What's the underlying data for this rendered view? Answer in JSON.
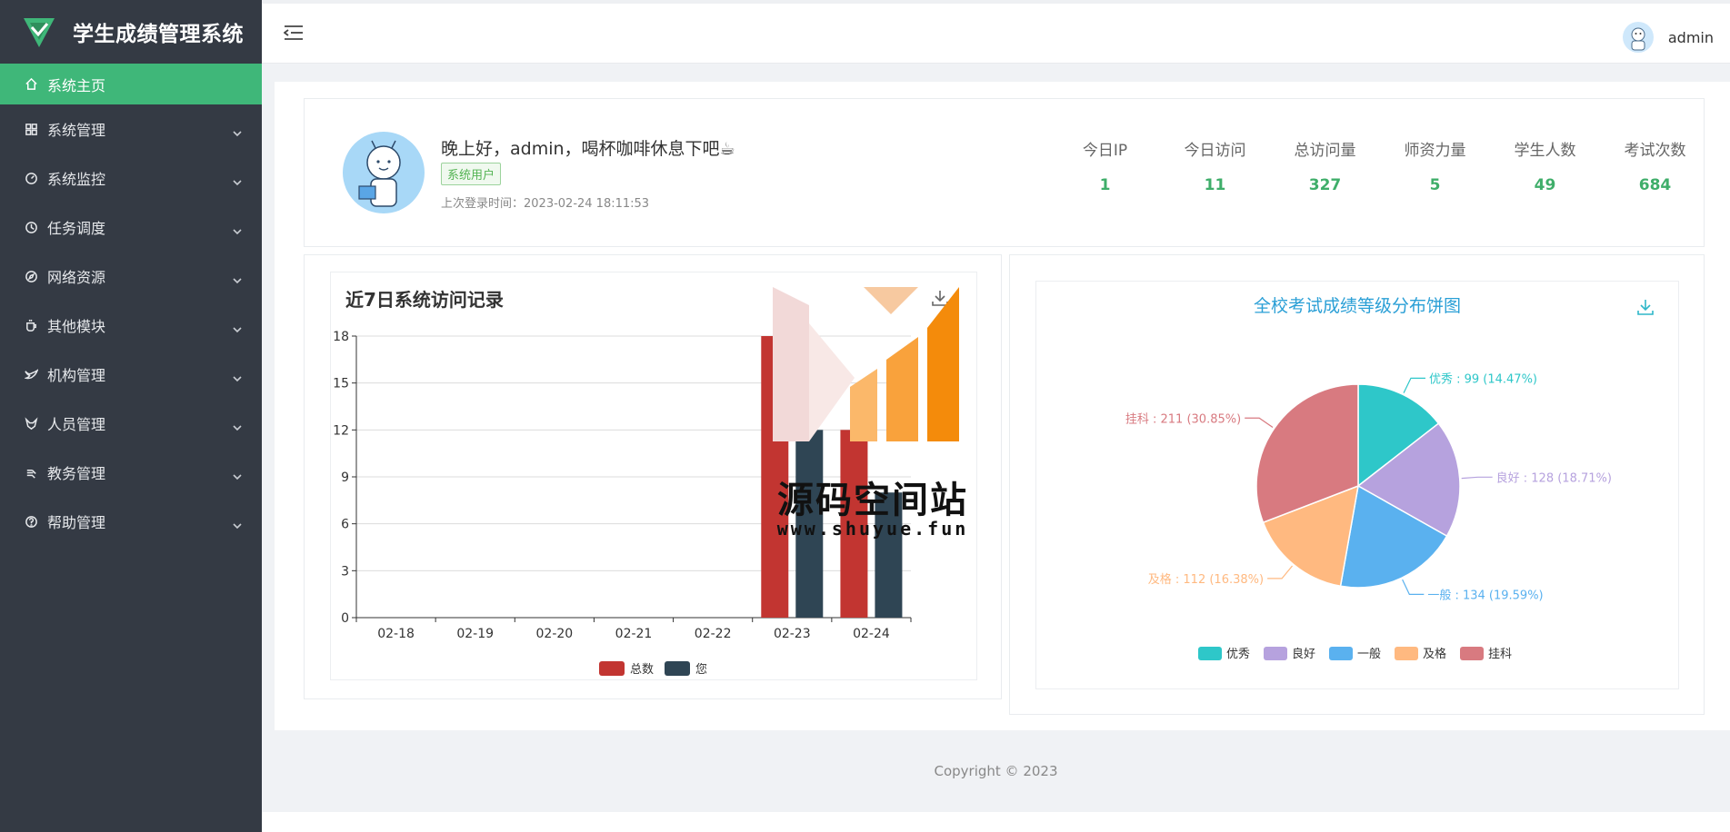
{
  "app": {
    "title": "学生成绩管理系统"
  },
  "sidebar": {
    "items": [
      {
        "label": "系统主页",
        "icon": "home-icon",
        "active": true
      },
      {
        "label": "系统管理",
        "icon": "grid-icon"
      },
      {
        "label": "系统监控",
        "icon": "dashboard-icon"
      },
      {
        "label": "任务调度",
        "icon": "clock-icon"
      },
      {
        "label": "网络资源",
        "icon": "compass-icon"
      },
      {
        "label": "其他模块",
        "icon": "cup-icon"
      },
      {
        "label": "机构管理",
        "icon": "bird-icon"
      },
      {
        "label": "人员管理",
        "icon": "fox-icon"
      },
      {
        "label": "教务管理",
        "icon": "hand-icon"
      },
      {
        "label": "帮助管理",
        "icon": "question-icon"
      }
    ]
  },
  "header": {
    "user": "admin"
  },
  "welcome": {
    "greeting": "晚上好，admin，喝杯咖啡休息下吧☕",
    "role_badge": "系统用户",
    "last_login": "上次登录时间：2023-02-24 18:11:53"
  },
  "stats": [
    {
      "label": "今日IP",
      "value": "1"
    },
    {
      "label": "今日访问",
      "value": "11"
    },
    {
      "label": "总访问量",
      "value": "327"
    },
    {
      "label": "师资力量",
      "value": "5"
    },
    {
      "label": "学生人数",
      "value": "49"
    },
    {
      "label": "考试次数",
      "value": "684"
    }
  ],
  "chart_data": [
    {
      "type": "bar",
      "title": "近7日系统访问记录",
      "categories": [
        "02-18",
        "02-19",
        "02-20",
        "02-21",
        "02-22",
        "02-23",
        "02-24"
      ],
      "series": [
        {
          "name": "总数",
          "color": "#c23531",
          "values": [
            0,
            0,
            0,
            0,
            0,
            18,
            12
          ]
        },
        {
          "name": "您",
          "color": "#2f4554",
          "values": [
            0,
            0,
            0,
            0,
            0,
            12,
            8
          ]
        }
      ],
      "ylim": [
        0,
        18
      ],
      "yticks": [
        0,
        3,
        6,
        9,
        12,
        15,
        18
      ],
      "grid": true,
      "legend": "bottom-center"
    },
    {
      "type": "pie",
      "title": "全校考试成绩等级分布饼图",
      "slices": [
        {
          "name": "优秀",
          "value": 99,
          "percent": "14.47%",
          "color": "#2ec7c9"
        },
        {
          "name": "良好",
          "value": 128,
          "percent": "18.71%",
          "color": "#b6a2de"
        },
        {
          "name": "一般",
          "value": 134,
          "percent": "19.59%",
          "color": "#5ab1ef"
        },
        {
          "name": "及格",
          "value": 112,
          "percent": "16.38%",
          "color": "#ffb980"
        },
        {
          "name": "挂科",
          "value": 211,
          "percent": "30.85%",
          "color": "#d87a80"
        }
      ],
      "legend": "bottom-center"
    }
  ],
  "footer": {
    "copyright": "Copyright © 2023"
  },
  "watermark": {
    "text": "源码空间站",
    "url": "www.shuyue.fun"
  }
}
